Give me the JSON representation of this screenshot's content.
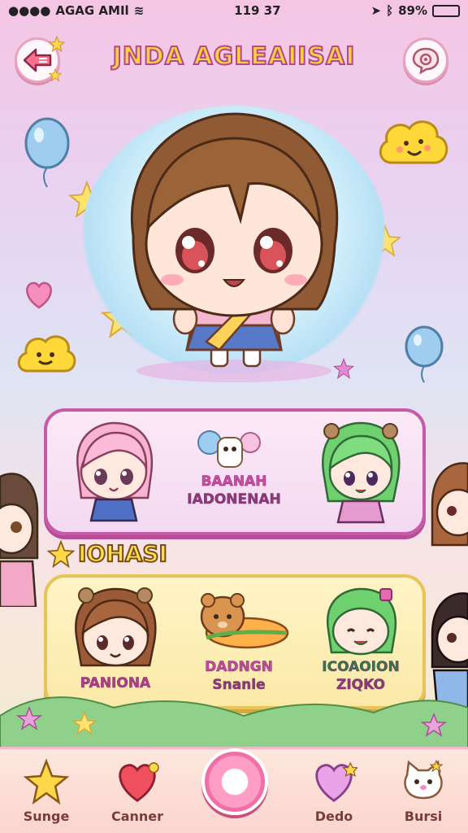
{
  "status_bar": {
    "carrier": "AGAG AMIl",
    "time": "119 37",
    "battery_percent": "89%",
    "battery_level": 0.89
  },
  "header": {
    "title": "JNDA AGLEAIISAI"
  },
  "card_one": {
    "center_title": "BAANAH",
    "center_subtitle": "IADONENAH"
  },
  "section": {
    "title": "IOHASI"
  },
  "card_two": {
    "items": [
      {
        "label": "PANIONA",
        "sub": ""
      },
      {
        "label": "DADNGN",
        "sub": "Snanle"
      },
      {
        "label": "ICOAOION",
        "sub": "ZIQKO"
      }
    ]
  },
  "tabbar": {
    "tabs": [
      {
        "label": "Sunge",
        "icon": "star-icon"
      },
      {
        "label": "Canner",
        "icon": "heart-icon"
      },
      {
        "label": "",
        "icon": "home-ring-icon"
      },
      {
        "label": "Dedo",
        "icon": "heart-gem-icon"
      },
      {
        "label": "Bursi",
        "icon": "cat-icon"
      }
    ]
  },
  "colors": {
    "accent_pink": "#c65aa8",
    "accent_yellow": "#ffd23f",
    "battery_green": "#2f9e3b"
  }
}
